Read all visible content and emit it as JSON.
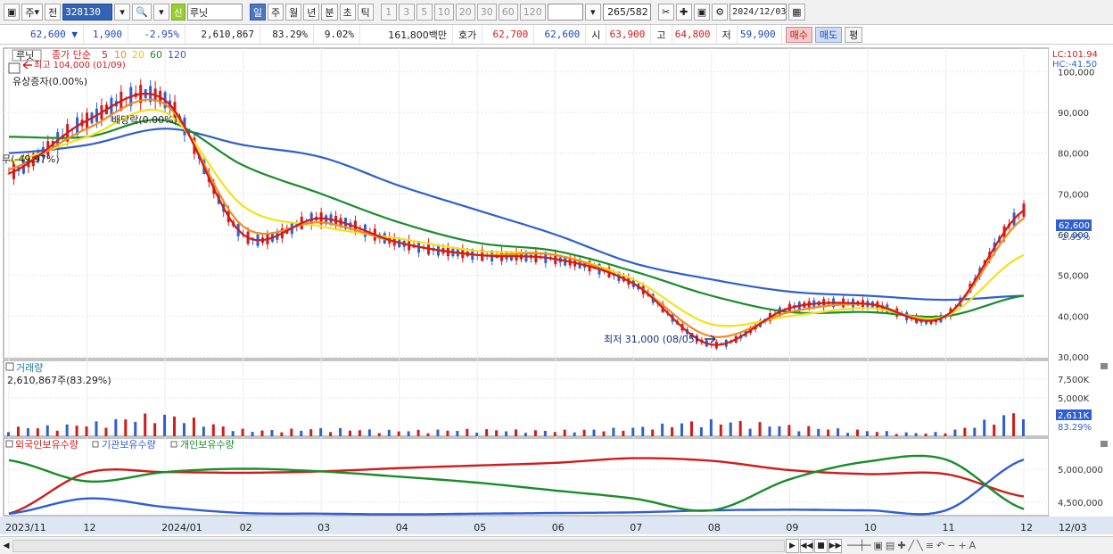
{
  "toolbar": {
    "period_type": "주",
    "prev_label": "전",
    "code": "328130",
    "shin_badge": "신",
    "stock_name": "루닛",
    "timeframes": [
      "일",
      "주",
      "월",
      "년",
      "분",
      "초",
      "틱"
    ],
    "active_timeframe": "일",
    "intervals": [
      "1",
      "3",
      "5",
      "10",
      "20",
      "30",
      "60",
      "120"
    ],
    "count_current": "265",
    "count_total": "/582",
    "date": "2024/12/03"
  },
  "quote": {
    "price": "62,600",
    "change": "1,900",
    "change_pct": "-2.95%",
    "volume": "2,610,867",
    "vol_ratio": "83.29%",
    "turnover": "9.02%",
    "amount": "161,800백만",
    "hoga_label": "호가",
    "ask": "62,700",
    "bid": "62,600",
    "open_label": "시",
    "open": "63,900",
    "high_label": "고",
    "high": "64,800",
    "low_label": "저",
    "low": "59,900",
    "buy_label": "매수",
    "sell_label": "매도",
    "eval_label": "평"
  },
  "price_pane": {
    "title": "루닛",
    "legend_label": "종가 단순",
    "ma_periods": [
      "5",
      "10",
      "20",
      "60",
      "120"
    ],
    "ma_colors": [
      "#d11b1b",
      "#f08c1c",
      "#f2e21a",
      "#1a8c2b",
      "#2f5fd0"
    ],
    "lc": "LC:101.94",
    "hc": "HC:-41.50",
    "y_ticks": [
      "100,000",
      "90,000",
      "80,000",
      "70,000",
      "60,000",
      "50,000",
      "40,000",
      "30,000"
    ],
    "current_price_tag": "62,600",
    "current_change_tag": "-2.95%",
    "annotations": {
      "high": "최고 104,000 (01/09)",
      "rights": "유상증자(0.00%)",
      "dividend": "배당락(0.00%)",
      "left": "무(-49.97%)",
      "low": "최저 31,000 (08/05)"
    }
  },
  "volume_pane": {
    "title": "거래량",
    "value_label": "2,610,867주(83.29%)",
    "y_ticks": [
      "7,500K",
      "5,000K"
    ],
    "current_tag": "2,611K",
    "current_pct": "83.29%"
  },
  "holding_pane": {
    "legend": [
      "외국인보유수량",
      "기관보유수량",
      "개인보유수량"
    ],
    "legend_colors": [
      "#d11b1b",
      "#2f5fd0",
      "#1a8c2b"
    ],
    "y_ticks": [
      "5,000,000",
      "4,500,000"
    ]
  },
  "x_axis": {
    "labels": [
      "2023/11",
      "12",
      "2024/01",
      "02",
      "03",
      "04",
      "05",
      "06",
      "07",
      "08",
      "09",
      "10",
      "11",
      "12"
    ],
    "right_label": "12/03"
  },
  "chart_data": [
    {
      "type": "line",
      "title": "루닛",
      "ylim": [
        30000,
        104000
      ],
      "x": [
        "2023/11",
        "12",
        "2024/01",
        "02",
        "03",
        "04",
        "05",
        "06",
        "07",
        "08",
        "09",
        "10",
        "11",
        "12"
      ],
      "series": [
        {
          "name": "5",
          "values": [
            75000,
            88000,
            93000,
            60000,
            64000,
            58000,
            55000,
            54000,
            48000,
            33000,
            42000,
            43000,
            40000,
            66000
          ]
        },
        {
          "name": "10",
          "values": [
            76000,
            86000,
            92000,
            62000,
            63000,
            58000,
            55000,
            55000,
            48000,
            35000,
            41000,
            43000,
            40000,
            64000
          ]
        },
        {
          "name": "20",
          "values": [
            78000,
            84000,
            90000,
            67000,
            62000,
            59000,
            56000,
            55000,
            49000,
            38000,
            40000,
            42000,
            40000,
            55000
          ]
        },
        {
          "name": "60",
          "values": [
            84000,
            84000,
            88000,
            77000,
            70000,
            63000,
            58000,
            56000,
            51000,
            45000,
            41000,
            41000,
            40000,
            45000
          ]
        },
        {
          "name": "120",
          "values": [
            80000,
            82000,
            86000,
            82000,
            79000,
            72000,
            66000,
            60000,
            53000,
            49000,
            46000,
            45000,
            44000,
            45000
          ]
        }
      ]
    },
    {
      "type": "bar",
      "title": "거래량",
      "ylim": [
        0,
        9000000
      ],
      "x": [
        "2023/11",
        "12",
        "2024/01",
        "02",
        "03",
        "04",
        "05",
        "06",
        "07",
        "08",
        "09",
        "10",
        "11",
        "12"
      ],
      "series": [
        {
          "name": "거래량",
          "values": [
            900000,
            1300000,
            2200000,
            700000,
            800000,
            600000,
            700000,
            600000,
            900000,
            1600000,
            1100000,
            600000,
            500000,
            2611000
          ]
        }
      ]
    },
    {
      "type": "line",
      "ylim": [
        4300000,
        5300000
      ],
      "x": [
        "2023/11",
        "12",
        "2024/01",
        "02",
        "03",
        "04",
        "05",
        "06",
        "07",
        "08",
        "09",
        "10",
        "11",
        "12"
      ],
      "series": [
        {
          "name": "외국인보유수량",
          "values": [
            4330000,
            4950000,
            4960000,
            4950000,
            4970000,
            5020000,
            5060000,
            5100000,
            5170000,
            5130000,
            4990000,
            4930000,
            4930000,
            4590000
          ]
        },
        {
          "name": "기관보유수량",
          "values": [
            4330000,
            4560000,
            4430000,
            4340000,
            4330000,
            4320000,
            4330000,
            4340000,
            4350000,
            4380000,
            4390000,
            4380000,
            4380000,
            5150000
          ]
        },
        {
          "name": "개인보유수량",
          "values": [
            5140000,
            4820000,
            4960000,
            5010000,
            4970000,
            4890000,
            4800000,
            4680000,
            4560000,
            4380000,
            4850000,
            5120000,
            5150000,
            4400000
          ]
        }
      ]
    }
  ]
}
